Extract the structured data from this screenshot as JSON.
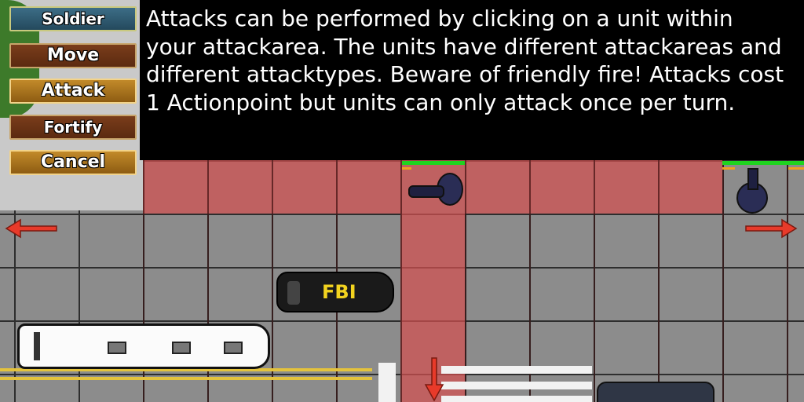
{
  "menu": {
    "title": "Soldier",
    "move": "Move",
    "attack": "Attack",
    "fortify": "Fortify",
    "cancel": "Cancel"
  },
  "tooltip": {
    "text": "Attacks can be performed by clicking on a unit within your attackarea. The units have different attackareas and different attacktypes. Beware of friendly fire! Attacks cost 1 Actionpoint but units can only attack once per turn."
  },
  "vehicles": {
    "fbi_label": "FBI"
  },
  "colors": {
    "attack_area": "#d25050",
    "health": "#1fd31f",
    "action_points": "#f0a020",
    "arrow": "#e83a2a"
  }
}
